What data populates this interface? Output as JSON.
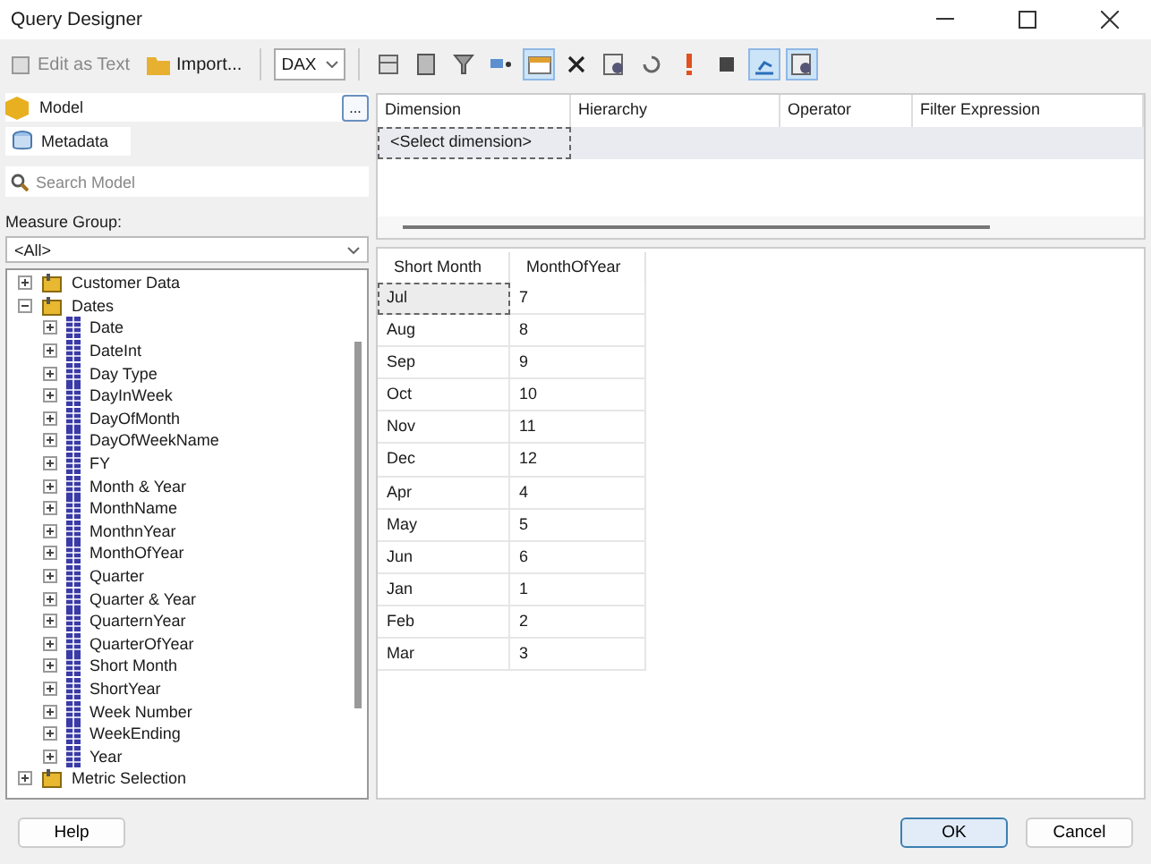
{
  "window": {
    "title": "Query Designer"
  },
  "toolbar": {
    "edit_as_text": "Edit as Text",
    "import": "Import...",
    "language": "DAX",
    "tools": [
      {
        "kind": "grid",
        "pressed": false
      },
      {
        "kind": "calc",
        "pressed": false
      },
      {
        "kind": "filter",
        "pressed": false
      },
      {
        "kind": "params",
        "pressed": false
      },
      {
        "kind": "table",
        "pressed": true
      },
      {
        "kind": "delete",
        "pressed": false
      },
      {
        "kind": "sheet",
        "pressed": false
      },
      {
        "kind": "refresh",
        "pressed": false
      },
      {
        "kind": "exclaim",
        "pressed": false
      },
      {
        "kind": "stop",
        "pressed": false
      },
      {
        "kind": "chart",
        "pressed": true
      },
      {
        "kind": "sheet",
        "pressed": true
      }
    ]
  },
  "sidebar": {
    "model": "Model",
    "more": "...",
    "metadata_tab": "Metadata",
    "search": {
      "placeholder": "Search Model"
    },
    "measure_group_label": "Measure Group:",
    "measure_group": "<All>",
    "tree": [
      {
        "label": "Customer Data",
        "kind": "table",
        "expanded": false
      },
      {
        "label": "Dates",
        "kind": "table",
        "expanded": true,
        "children": [
          {
            "label": "Date",
            "kind": "attr",
            "expanded": false
          },
          {
            "label": "DateInt",
            "kind": "attr",
            "expanded": false
          },
          {
            "label": "Day Type",
            "kind": "attr",
            "expanded": false
          },
          {
            "label": "DayInWeek",
            "kind": "attr",
            "expanded": false
          },
          {
            "label": "DayOfMonth",
            "kind": "attr",
            "expanded": false
          },
          {
            "label": "DayOfWeekName",
            "kind": "attr",
            "expanded": false
          },
          {
            "label": "FY",
            "kind": "attr",
            "expanded": false
          },
          {
            "label": "Month & Year",
            "kind": "attr",
            "expanded": false
          },
          {
            "label": "MonthName",
            "kind": "attr",
            "expanded": false
          },
          {
            "label": "MonthnYear",
            "kind": "attr",
            "expanded": false
          },
          {
            "label": "MonthOfYear",
            "kind": "attr",
            "expanded": false
          },
          {
            "label": "Quarter",
            "kind": "attr",
            "expanded": false
          },
          {
            "label": "Quarter & Year",
            "kind": "attr",
            "expanded": false
          },
          {
            "label": "QuarternYear",
            "kind": "attr",
            "expanded": false
          },
          {
            "label": "QuarterOfYear",
            "kind": "attr",
            "expanded": false
          },
          {
            "label": "Short Month",
            "kind": "attr",
            "expanded": false
          },
          {
            "label": "ShortYear",
            "kind": "attr",
            "expanded": false
          },
          {
            "label": "Week Number",
            "kind": "attr",
            "expanded": false
          },
          {
            "label": "WeekEnding",
            "kind": "attr",
            "expanded": false
          },
          {
            "label": "Year",
            "kind": "attr",
            "expanded": false
          }
        ]
      },
      {
        "label": "Metric Selection",
        "kind": "table",
        "expanded": false
      }
    ]
  },
  "filter_grid": {
    "columns": [
      "Dimension",
      "Hierarchy",
      "Operator",
      "Filter Expression"
    ],
    "rows": [
      [
        "<Select dimension>"
      ]
    ]
  },
  "data_grid": {
    "columns": [
      "Short Month",
      "MonthOfYear"
    ],
    "rows": [
      [
        "Jul",
        "7"
      ],
      [
        "Aug",
        "8"
      ],
      [
        "Sep",
        "9"
      ],
      [
        "Oct",
        "10"
      ],
      [
        "Nov",
        "11"
      ],
      [
        "Dec",
        "12"
      ],
      [
        "Apr",
        "4"
      ],
      [
        "May",
        "5"
      ],
      [
        "Jun",
        "6"
      ],
      [
        "Jan",
        "1"
      ],
      [
        "Feb",
        "2"
      ],
      [
        "Mar",
        "3"
      ]
    ]
  },
  "buttons": {
    "help": "Help",
    "ok": "OK",
    "cancel": "Cancel"
  }
}
